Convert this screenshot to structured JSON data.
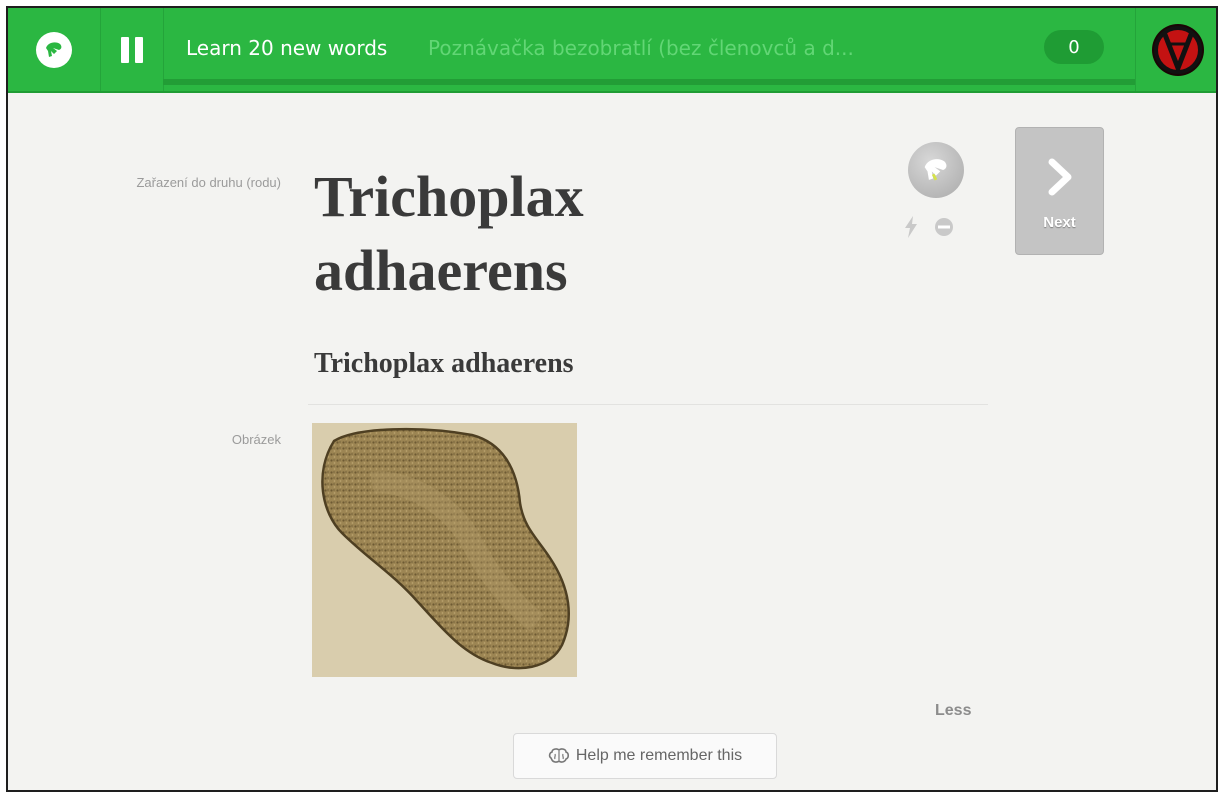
{
  "header": {
    "session_title": "Learn 20 new words",
    "course_title": "Poznávačka bezobratlí (bez členovců a d...",
    "score": "0",
    "progress_fraction": 0.0
  },
  "card": {
    "word_label": "Zařazení do druhu (rodu)",
    "word": "Trichoplax adhaerens",
    "word_secondary": "Trichoplax adhaerens",
    "image_label": "Obrázek"
  },
  "controls": {
    "next_label": "Next",
    "less_label": "Less",
    "help_label": "Help me remember this"
  },
  "icons": {
    "logo": "memrise-logo-icon",
    "pause": "pause-icon",
    "avatar": "user-avatar-icon",
    "memory": "memrise-mem-icon",
    "lightning": "lightning-icon",
    "ignore": "ignore-minus-icon",
    "next": "chevron-right-icon",
    "brain": "brain-icon"
  },
  "colors": {
    "header_bg": "#2bb742",
    "accent_dark": "#1f9c34",
    "next_button_bg": "#c4c4c4"
  }
}
